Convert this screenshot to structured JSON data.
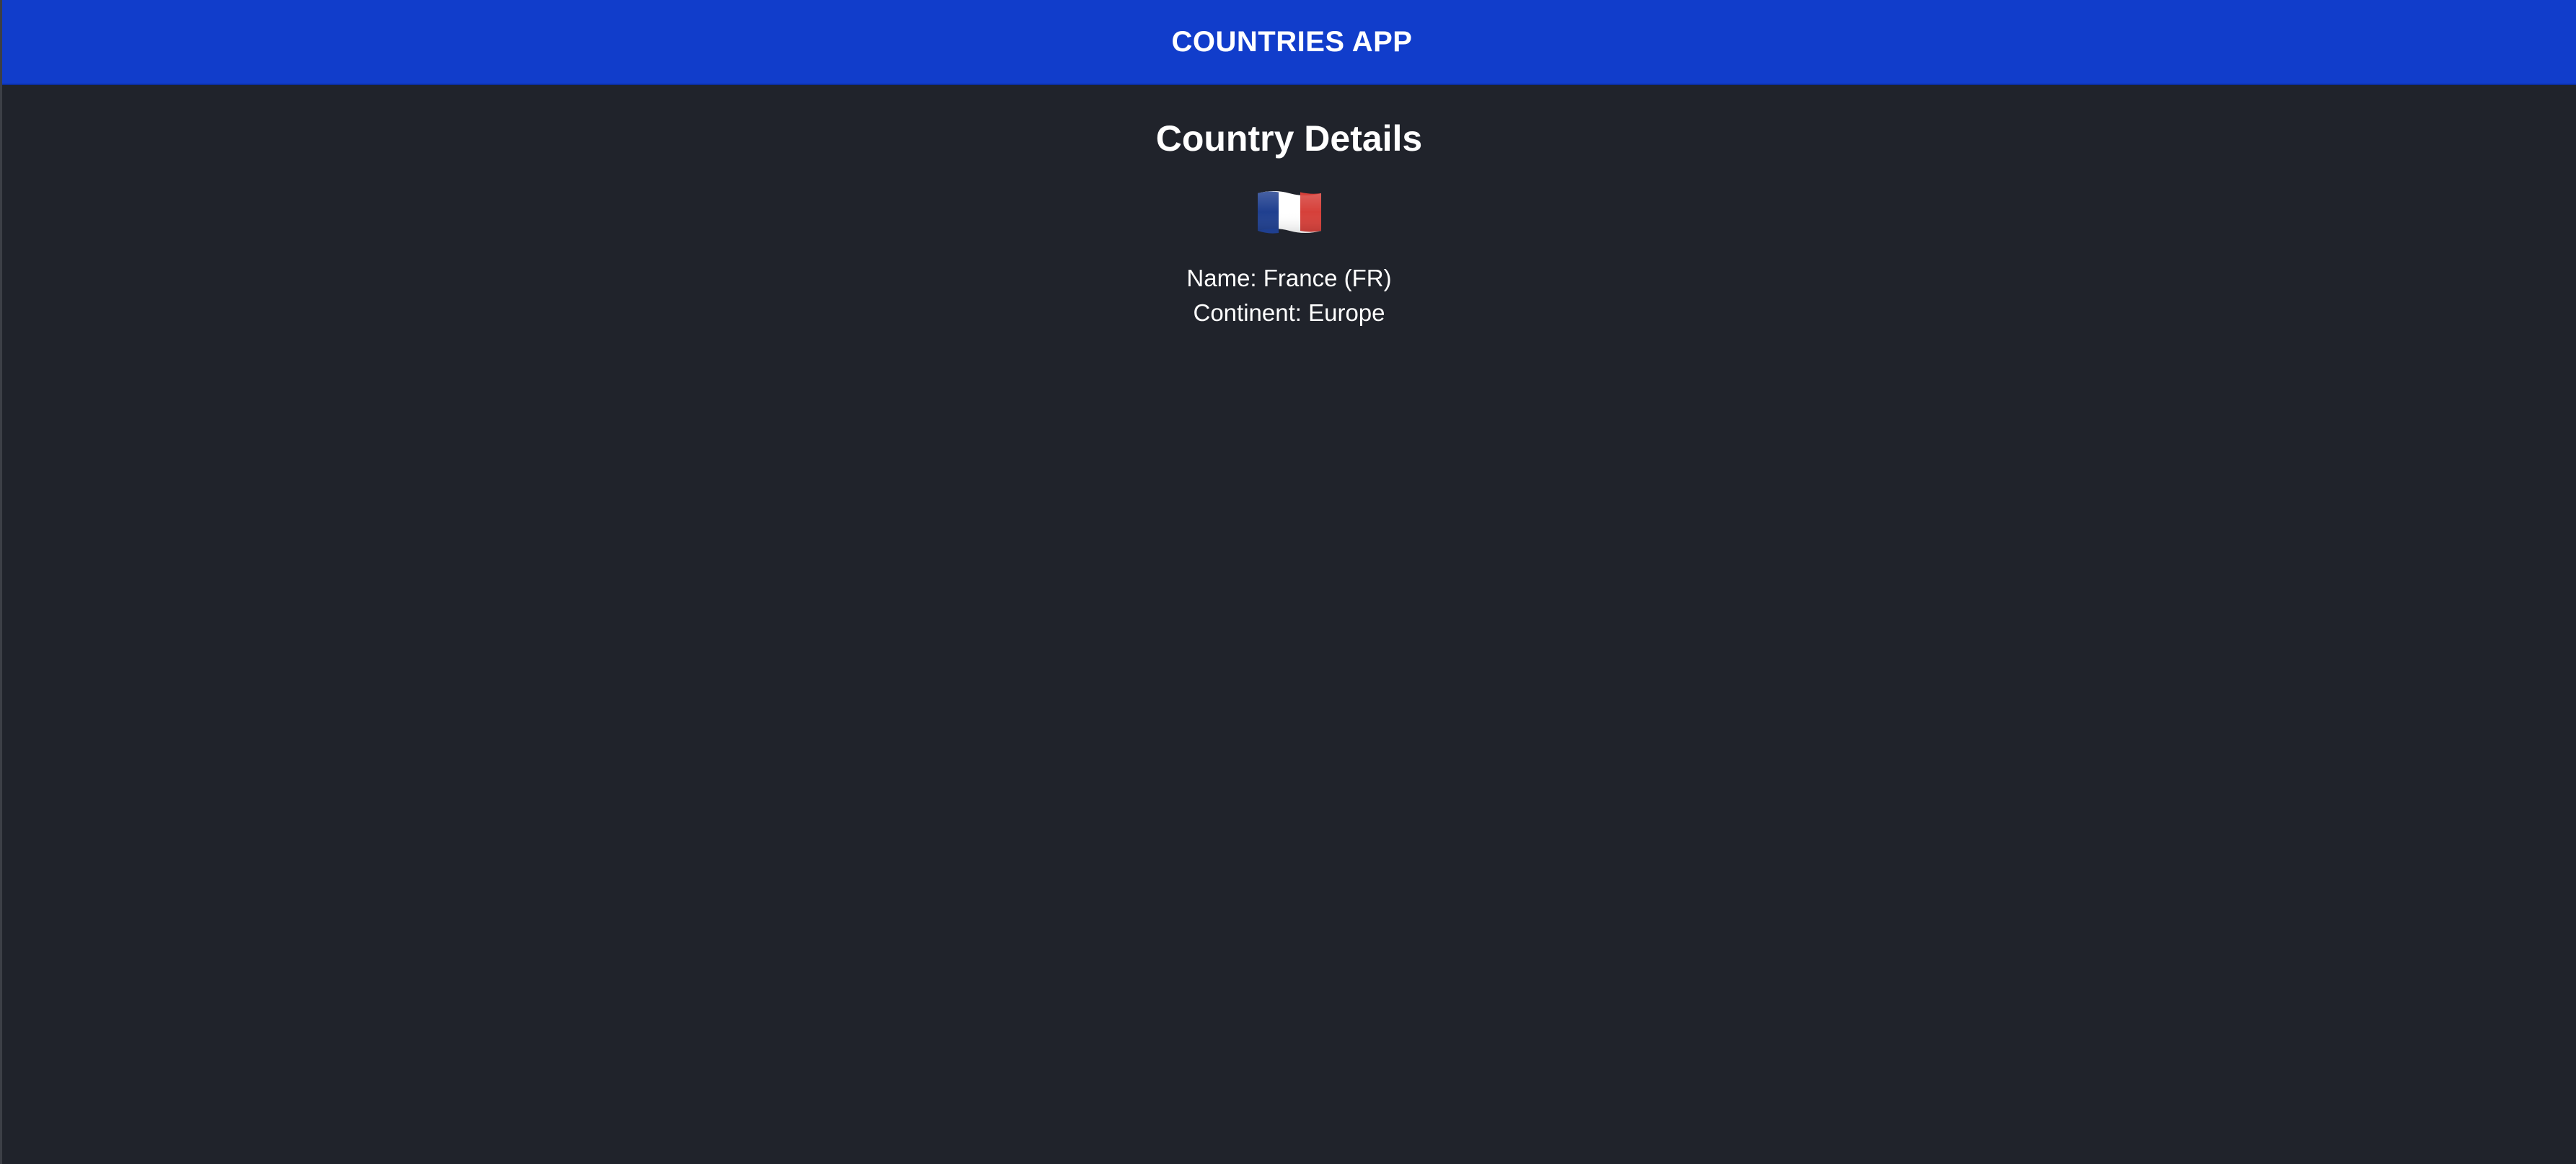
{
  "header": {
    "title": "COUNTRIES APP"
  },
  "main": {
    "title": "Country Details",
    "flag": {
      "icon": "france-flag-icon",
      "colors": {
        "blue": "#1f3f8f",
        "white": "#ffffff",
        "red": "#d6403a"
      }
    },
    "details": {
      "name_label": "Name:",
      "name_value": "France (FR)",
      "continent_label": "Continent:",
      "continent_value": "Europe"
    }
  },
  "colors": {
    "header_bg": "#113dcb",
    "page_bg": "#20232b",
    "text": "#ffffff"
  }
}
